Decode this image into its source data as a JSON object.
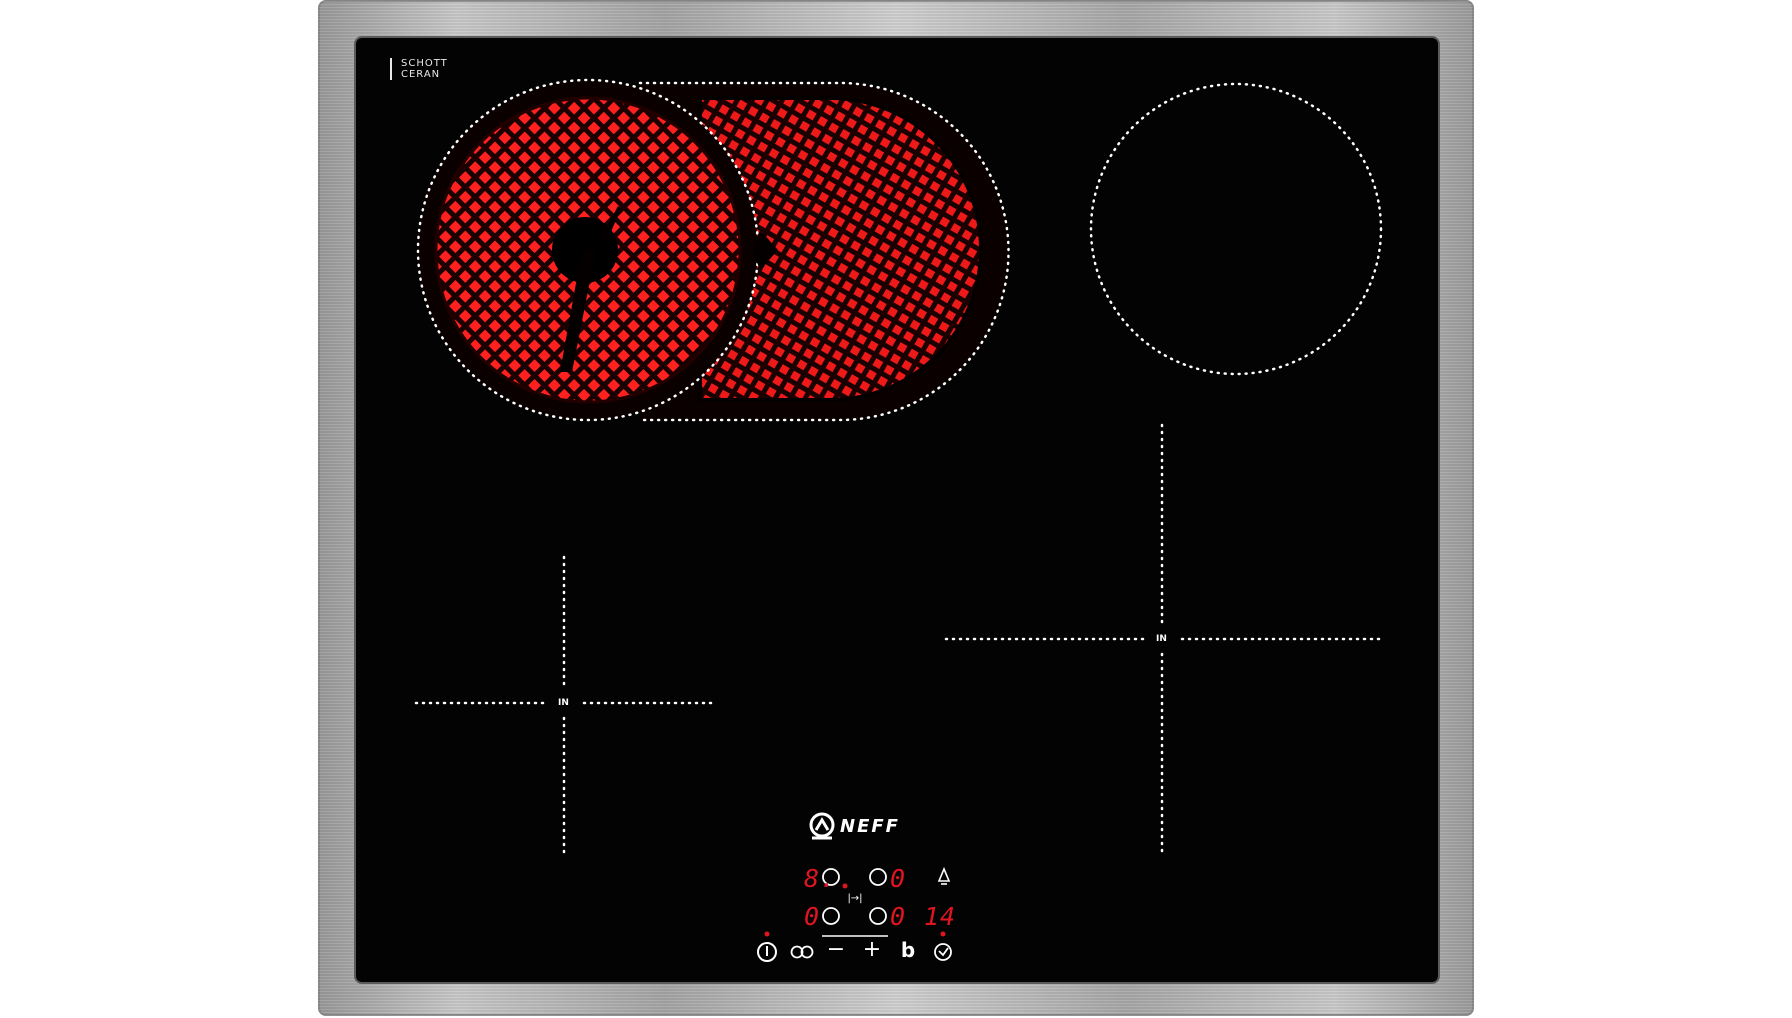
{
  "brand": {
    "glass_brand_line1": "SCHOTT",
    "glass_brand_line2": "CERAN",
    "maker_logo": "NEFF"
  },
  "zones": {
    "front_left_label": "IN",
    "rear_right_label": "IN"
  },
  "display": {
    "left_top_value": "8.",
    "left_bottom_value": "0",
    "right_top_value": "0",
    "right_bottom_value": "0",
    "timer_value": "14"
  },
  "controls": {
    "power_icon": "power-icon",
    "dual_zone_icon": "dual-zone-icon",
    "minus_label": "−",
    "plus_label": "+",
    "boost_label": "b",
    "timer_icon": "timer-icon",
    "bell_icon": "bell-icon",
    "move_icon": "|→|"
  },
  "colors": {
    "glow": "#ff1a1a",
    "display_red": "#e0151f",
    "glass": "#030303"
  }
}
